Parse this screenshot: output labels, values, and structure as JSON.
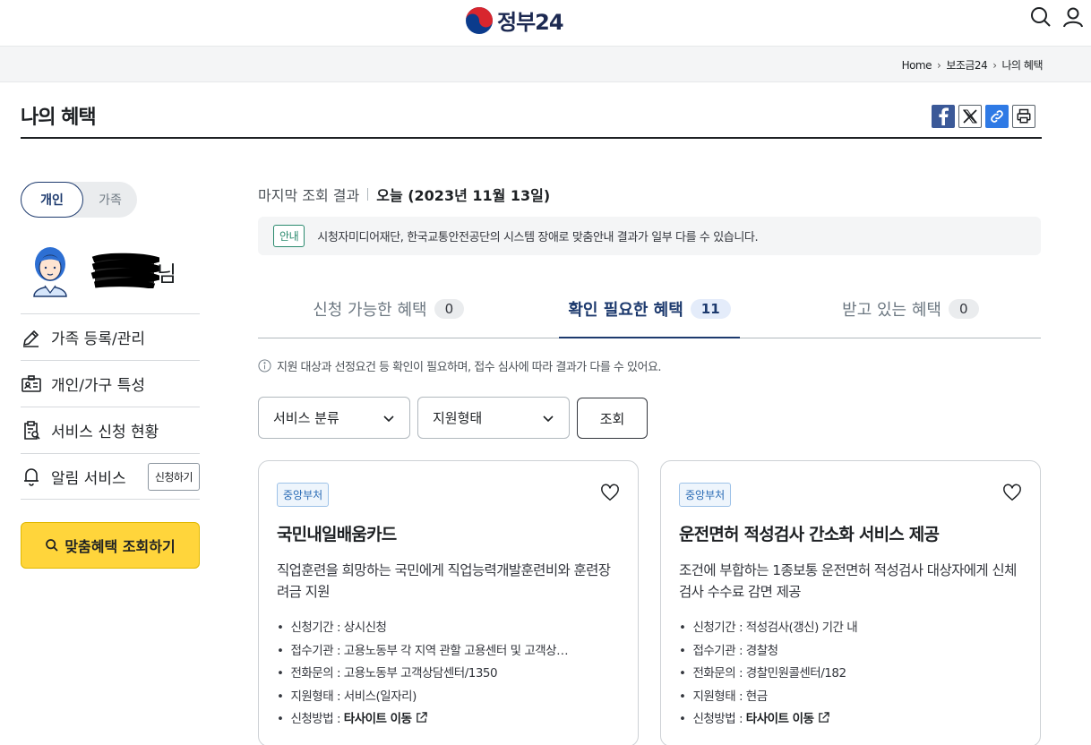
{
  "header": {
    "logo_text": "정부24"
  },
  "breadcrumb": {
    "items": [
      "Home",
      "보조금24",
      "나의 혜택"
    ]
  },
  "page": {
    "title": "나의 혜택"
  },
  "sidebar": {
    "segment": {
      "personal": "개인",
      "family": "가족"
    },
    "user_suffix": "님",
    "items": [
      {
        "label": "가족 등록/관리",
        "icon": "pencil-icon"
      },
      {
        "label": "개인/가구 특성",
        "icon": "id-card-icon"
      },
      {
        "label": "서비스 신청 현황",
        "icon": "clipboard-search-icon"
      },
      {
        "label": "알림 서비스",
        "icon": "bell-icon",
        "action": "신청하기"
      }
    ],
    "search_button": "맞춤혜택 조회하기"
  },
  "main": {
    "last_view_label": "마지막 조회 결과",
    "last_view_value": "오늘 (2023년 11월 13일)",
    "notice_tag": "안내",
    "notice_text": "시청자미디어재단, 한국교통안전공단의 시스템 장애로 맞춤안내 결과가 일부 다를 수 있습니다.",
    "tabs": [
      {
        "label": "신청 가능한 혜택",
        "count": "0",
        "active": false
      },
      {
        "label": "확인 필요한 혜택",
        "count": "11",
        "active": true
      },
      {
        "label": "받고 있는 혜택",
        "count": "0",
        "active": false
      }
    ],
    "hint": "지원 대상과 선정요건 등 확인이 필요하며, 접수 심사에 따라 결과가 다를 수 있어요.",
    "filters": {
      "category": "서비스 분류",
      "support_type": "지원형태",
      "query_button": "조회"
    },
    "cards": [
      {
        "tag": "중앙부처",
        "title": "국민내일배움카드",
        "desc": "직업훈련을 희망하는 국민에게 직업능력개발훈련비와 훈련장려금 지원",
        "rows": [
          {
            "k": "신청기간 : ",
            "v": "상시신청"
          },
          {
            "k": "접수기관 : ",
            "v": "고용노동부 각 지역 관할 고용센터 및 고객상…"
          },
          {
            "k": "전화문의 : ",
            "v": "고용노동부 고객상담센터/1350"
          },
          {
            "k": "지원형태 : ",
            "v": "서비스(일자리)"
          },
          {
            "k": "신청방법 : ",
            "v": "타사이트 이동"
          }
        ]
      },
      {
        "tag": "중앙부처",
        "title": "운전면허 적성검사 간소화 서비스 제공",
        "desc": "조건에 부합하는 1종보통 운전면허 적성검사 대상자에게 신체검사 수수료 감면 제공",
        "rows": [
          {
            "k": "신청기간 : ",
            "v": "적성검사(갱신) 기간 내"
          },
          {
            "k": "접수기관 : ",
            "v": "경찰청"
          },
          {
            "k": "전화문의 : ",
            "v": "경찰민원콜센터/182"
          },
          {
            "k": "지원형태 : ",
            "v": "현금"
          },
          {
            "k": "신청방법 : ",
            "v": "타사이트 이동"
          }
        ]
      }
    ]
  }
}
